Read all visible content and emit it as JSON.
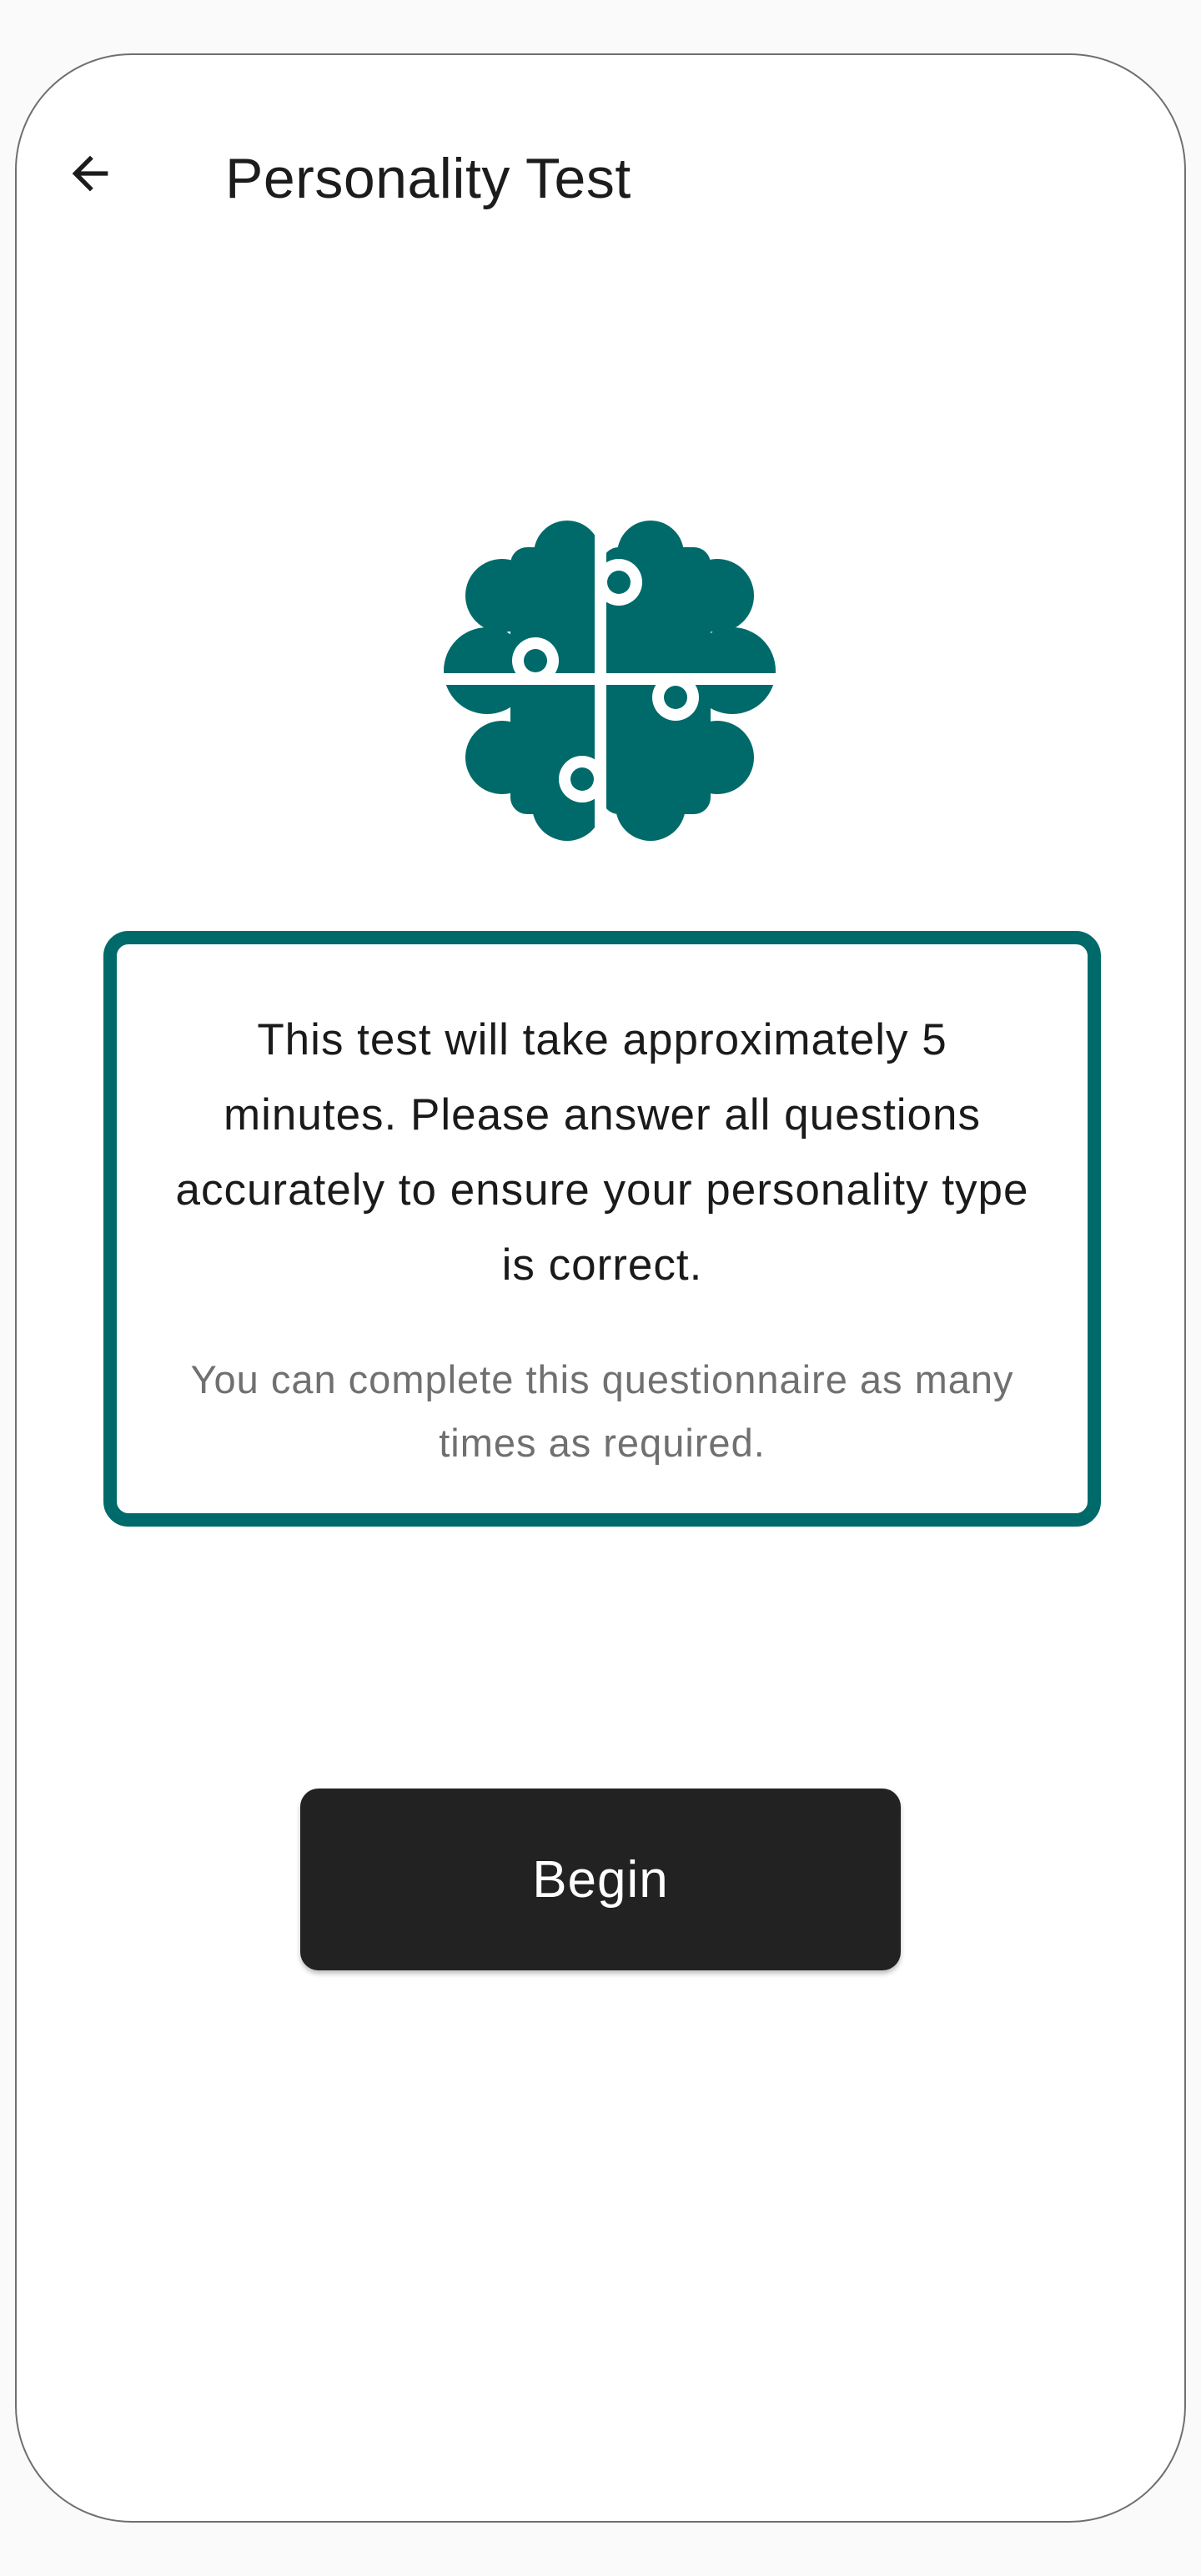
{
  "header": {
    "title": "Personality Test",
    "back_icon": "arrow-back-icon"
  },
  "hero": {
    "icon": "brain-puzzle-icon",
    "color": "#006a6a"
  },
  "info_card": {
    "main_text": "This test will take approximately 5 minutes. Please answer all questions accurately to ensure your personality type is correct.",
    "sub_text": "You can complete this questionnaire as many times as required.",
    "border_color": "#006a6a"
  },
  "actions": {
    "begin_label": "Begin",
    "button_color": "#222222"
  }
}
